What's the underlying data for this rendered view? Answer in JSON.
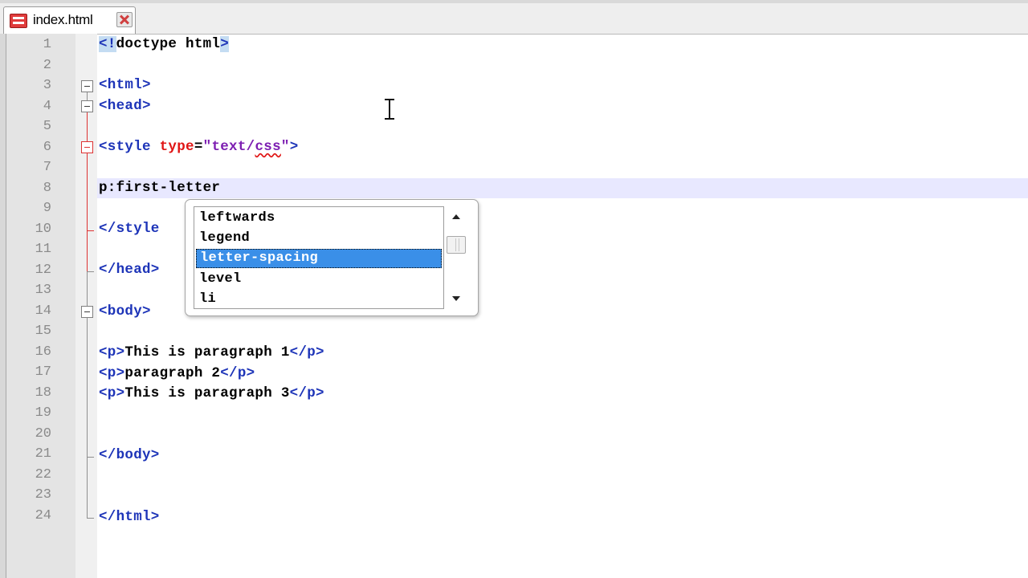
{
  "tab": {
    "title": "index.html",
    "icon": "html-file-icon",
    "close_icon": "close-icon"
  },
  "editor": {
    "line_numbers": [
      "1",
      "2",
      "3",
      "4",
      "5",
      "6",
      "7",
      "8",
      "9",
      "10",
      "11",
      "12",
      "13",
      "14",
      "15",
      "16",
      "17",
      "18",
      "19",
      "20",
      "21",
      "22",
      "23",
      "24"
    ],
    "current_line": 8,
    "lines": {
      "l1": {
        "tag_open": "<!",
        "rest": "doctype html",
        "tag_close": ">"
      },
      "l3": "<html>",
      "l4": "<head>",
      "l6": {
        "tag_open": "<style ",
        "attr": "type",
        "eq": "=",
        "str_open": "\"text/",
        "str_squiggle": "css",
        "str_close": "\"",
        "tag_close": ">"
      },
      "l8": "p:first-letter",
      "l10": "</style",
      "l12": "</head>",
      "l14": "<body>",
      "l16": {
        "open": "<p>",
        "text": "This is paragraph 1",
        "close": "</p>"
      },
      "l17": {
        "open": "<p>",
        "text": "paragraph 2",
        "close": "</p>"
      },
      "l18": {
        "open": "<p>",
        "text": "This is paragraph 3",
        "close": "</p>"
      },
      "l21": "</body>",
      "l24": "</html>"
    }
  },
  "autocomplete": {
    "items": [
      "leftwards",
      "legend",
      "letter-spacing",
      "level",
      "li"
    ],
    "selected": "letter-spacing",
    "selected_color": "#3a8fe8"
  },
  "colors": {
    "tag": "#1d34b8",
    "attribute": "#e01515",
    "string": "#7d1fb2",
    "current_line": "#e8e8ff"
  }
}
